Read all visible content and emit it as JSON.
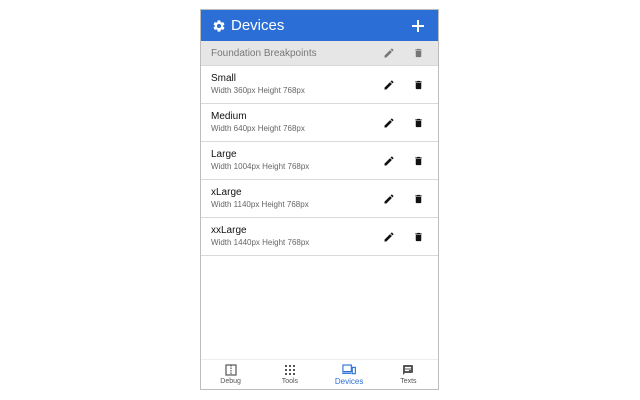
{
  "header": {
    "title": "Devices",
    "icon": "gear-icon",
    "add_icon": "plus-icon"
  },
  "group": {
    "label": "Foundation Breakpoints"
  },
  "devices": [
    {
      "name": "Small",
      "dims": "Width 360px Height 768px"
    },
    {
      "name": "Medium",
      "dims": "Width 640px Height 768px"
    },
    {
      "name": "Large",
      "dims": "Width 1004px Height 768px"
    },
    {
      "name": "xLarge",
      "dims": "Width 1140px Height 768px"
    },
    {
      "name": "xxLarge",
      "dims": "Width 1440px Height 768px"
    }
  ],
  "nav": {
    "items": [
      {
        "label": "Debug",
        "icon": "split-panel-icon"
      },
      {
        "label": "Tools",
        "icon": "grid-icon"
      },
      {
        "label": "Devices",
        "icon": "devices-icon",
        "active": true
      },
      {
        "label": "Texts",
        "icon": "message-icon"
      }
    ]
  },
  "colors": {
    "accent": "#2b6fd6",
    "group_bg": "#e6e6e6"
  }
}
